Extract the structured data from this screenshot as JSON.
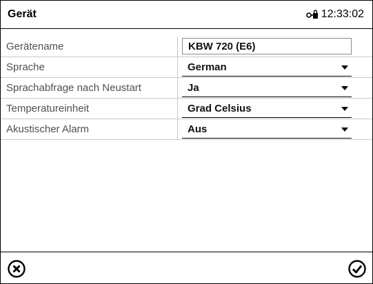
{
  "header": {
    "title": "Gerät",
    "time": "12:33:02",
    "time_icon": "key-lock-icon"
  },
  "settings": [
    {
      "label": "Gerätename",
      "value": "KBW 720 (E6)",
      "type": "text"
    },
    {
      "label": "Sprache",
      "value": "German",
      "type": "select"
    },
    {
      "label": "Sprachabfrage nach Neustart",
      "value": "Ja",
      "type": "select"
    },
    {
      "label": "Temperatureinheit",
      "value": "Grad Celsius",
      "type": "select"
    },
    {
      "label": "Akustischer Alarm",
      "value": "Aus",
      "type": "select"
    }
  ],
  "footer": {
    "cancel_icon": "cancel-circle-icon",
    "confirm_icon": "confirm-check-circle-icon"
  }
}
